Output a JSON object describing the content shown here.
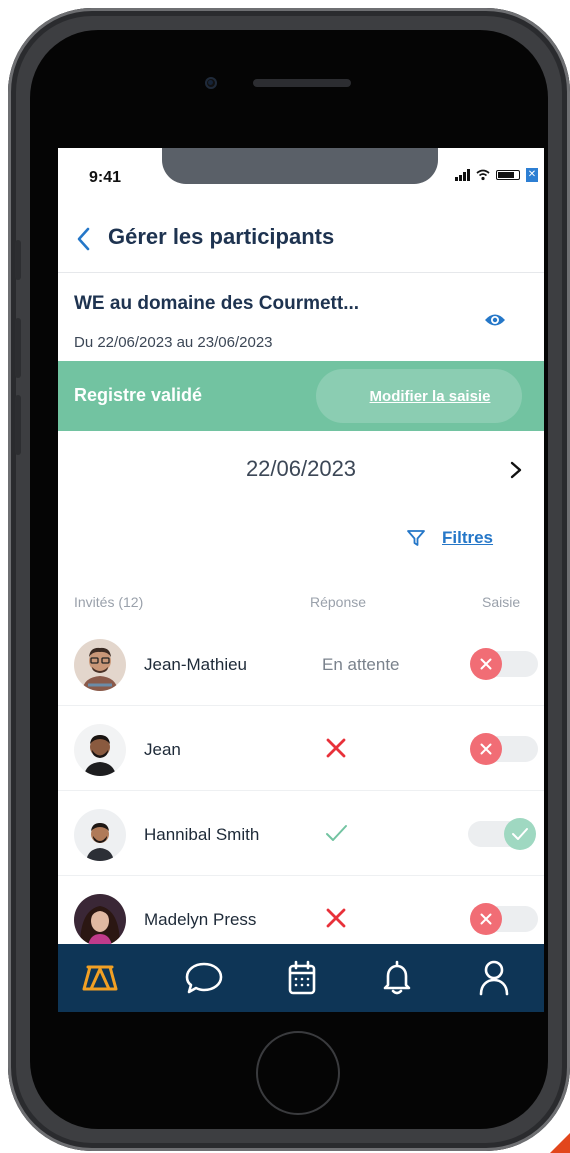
{
  "status_bar": {
    "time": "9:41"
  },
  "header": {
    "title": "Gérer les participants"
  },
  "event": {
    "title": "WE au domaine des Courmett...",
    "dates": "Du 22/06/2023 au 23/06/2023"
  },
  "banner": {
    "label": "Registre validé",
    "button": "Modifier la saisie"
  },
  "date_nav": {
    "date": "22/06/2023"
  },
  "filters": {
    "label": "Filtres"
  },
  "table": {
    "headers": {
      "guests": "Invités (12)",
      "response": "Réponse",
      "entry": "Saisie"
    },
    "rows": [
      {
        "name": "Jean-Mathieu",
        "response_text": "En attente",
        "response": "pending",
        "toggle": "off"
      },
      {
        "name": "Jean",
        "response_text": "",
        "response": "declined",
        "toggle": "off"
      },
      {
        "name": "Hannibal Smith",
        "response_text": "",
        "response": "accepted",
        "toggle": "on"
      },
      {
        "name": "Madelyn Press",
        "response_text": "",
        "response": "declined",
        "toggle": "off"
      }
    ]
  },
  "tabbar": {
    "items": [
      "tent-icon",
      "chat-icon",
      "calendar-icon",
      "bell-icon",
      "profile-icon"
    ]
  },
  "colors": {
    "navy": "#1e3350",
    "green": "#72c3a1",
    "blue": "#2577c8",
    "red": "#e8313a",
    "tabbar": "#0e3556",
    "active_tab": "#f2a024"
  }
}
